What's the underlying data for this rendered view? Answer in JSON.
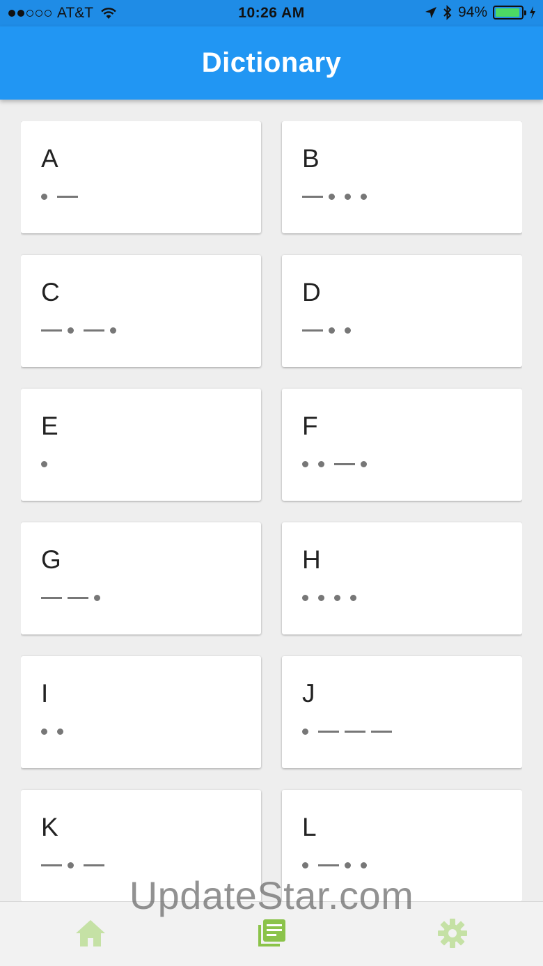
{
  "status_bar": {
    "carrier": "AT&T",
    "time": "10:26 AM",
    "battery": "94%",
    "battery_level": 0.94,
    "signal_bars": 2
  },
  "app_bar": {
    "title": "Dictionary"
  },
  "cards": [
    {
      "letter": "A",
      "code": ".-"
    },
    {
      "letter": "B",
      "code": "-..."
    },
    {
      "letter": "C",
      "code": "-.-."
    },
    {
      "letter": "D",
      "code": "-.."
    },
    {
      "letter": "E",
      "code": "."
    },
    {
      "letter": "F",
      "code": "..-."
    },
    {
      "letter": "G",
      "code": "--."
    },
    {
      "letter": "H",
      "code": "...."
    },
    {
      "letter": "I",
      "code": ".."
    },
    {
      "letter": "J",
      "code": ".---"
    },
    {
      "letter": "K",
      "code": "-.-"
    },
    {
      "letter": "L",
      "code": ".-.."
    }
  ],
  "watermark": "UpdateStar.com",
  "bottom_nav": [
    {
      "name": "home-icon",
      "active": false
    },
    {
      "name": "dictionary-icon",
      "active": true
    },
    {
      "name": "settings-icon",
      "active": false
    }
  ],
  "colors": {
    "app_bar": "#2196f3",
    "status_bar": "#1f8ce6",
    "nav_active": "#8bc34a",
    "nav_inactive": "#c5e1a5",
    "morse": "#777777"
  }
}
